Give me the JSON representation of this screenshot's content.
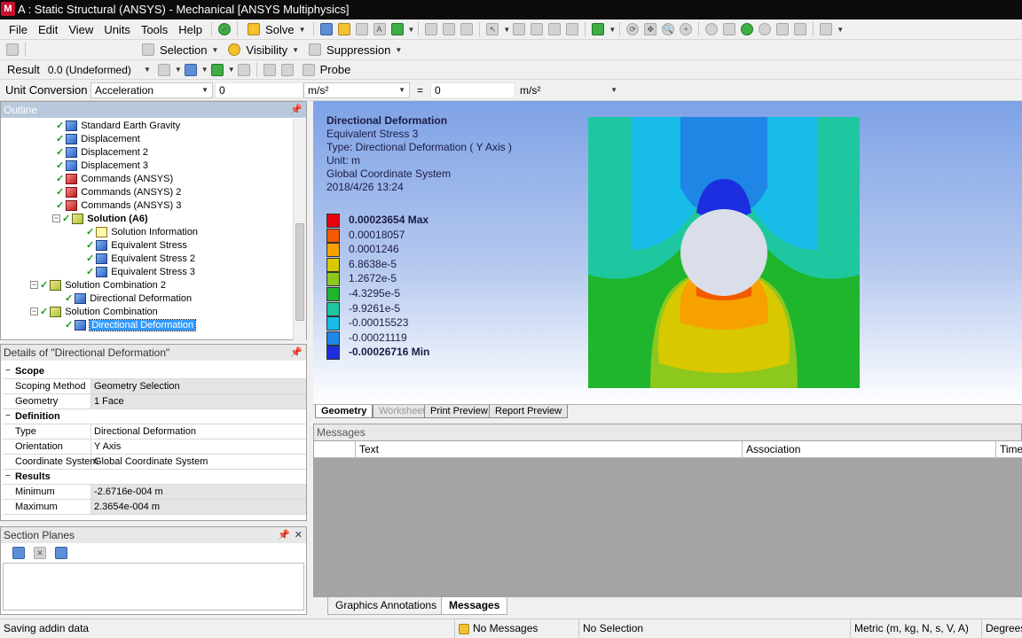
{
  "window": {
    "title": "A : Static Structural (ANSYS) - Mechanical [ANSYS Multiphysics]"
  },
  "menu": [
    "File",
    "Edit",
    "View",
    "Units",
    "Tools",
    "Help"
  ],
  "toolbar": {
    "solve_label": "Solve",
    "selection_label": "Selection",
    "visibility_label": "Visibility",
    "suppression_label": "Suppression",
    "result_label": "Result",
    "result_value": "0.0 (Undeformed)",
    "probe_label": "Probe"
  },
  "unit_conversion": {
    "label": "Unit Conversion",
    "quantity": "Acceleration",
    "left_value": "0",
    "left_unit": "m/s²",
    "equals": "=",
    "right_value": "0",
    "right_unit": "m/s²"
  },
  "outline": {
    "title": "Outline",
    "items": [
      {
        "label": "Standard Earth Gravity"
      },
      {
        "label": "Displacement"
      },
      {
        "label": "Displacement 2"
      },
      {
        "label": "Displacement 3"
      },
      {
        "label": "Commands (ANSYS)"
      },
      {
        "label": "Commands (ANSYS) 2"
      },
      {
        "label": "Commands (ANSYS) 3"
      },
      {
        "label": "Solution (A6)"
      },
      {
        "label": "Solution Information"
      },
      {
        "label": "Equivalent Stress"
      },
      {
        "label": "Equivalent Stress 2"
      },
      {
        "label": "Equivalent Stress 3"
      },
      {
        "label": "Solution Combination 2"
      },
      {
        "label": "Directional Deformation"
      },
      {
        "label": "Solution Combination"
      },
      {
        "label": "Directional Deformation"
      }
    ]
  },
  "details": {
    "title": "Details of \"Directional Deformation\"",
    "groups": [
      {
        "name": "Scope",
        "rows": [
          {
            "key": "Scoping Method",
            "value": "Geometry Selection"
          },
          {
            "key": "Geometry",
            "value": "1 Face"
          }
        ]
      },
      {
        "name": "Definition",
        "rows": [
          {
            "key": "Type",
            "value": "Directional Deformation"
          },
          {
            "key": "Orientation",
            "value": "Y Axis"
          },
          {
            "key": "Coordinate System",
            "value": "Global Coordinate System"
          }
        ]
      },
      {
        "name": "Results",
        "rows": [
          {
            "key": "Minimum",
            "value": "-2.6716e-004 m"
          },
          {
            "key": "Maximum",
            "value": "2.3654e-004 m"
          }
        ]
      }
    ]
  },
  "section_planes": {
    "title": "Section Planes"
  },
  "viewport": {
    "result_title": "Directional Deformation",
    "subtitle": "Equivalent Stress 3",
    "type_line": "Type: Directional Deformation ( Y Axis )",
    "unit_line": "Unit: m",
    "coord_line": "Global Coordinate System",
    "date_line": "2018/4/26 13:24",
    "legend": [
      {
        "label": "0.00023654 Max",
        "color": "#e8000b"
      },
      {
        "label": "0.00018057",
        "color": "#f25a00"
      },
      {
        "label": "0.0001246",
        "color": "#f7a100"
      },
      {
        "label": "6.8638e-5",
        "color": "#d8c800"
      },
      {
        "label": "1.2672e-5",
        "color": "#8cc81e"
      },
      {
        "label": "-4.3295e-5",
        "color": "#1fb52c"
      },
      {
        "label": "-9.9261e-5",
        "color": "#1ec79f"
      },
      {
        "label": "-0.00015523",
        "color": "#17bde8"
      },
      {
        "label": "-0.00021119",
        "color": "#1f86e6"
      },
      {
        "label": "-0.00026716 Min",
        "color": "#1c2ee0"
      }
    ]
  },
  "view_tabs": [
    "Geometry",
    "Worksheet",
    "Print Preview",
    "Report Preview"
  ],
  "messages": {
    "title": "Messages",
    "columns": [
      "Text",
      "Association",
      "Time"
    ]
  },
  "bottom_tabs": [
    "Graphics Annotations",
    "Messages"
  ],
  "status": {
    "left": "Saving addin data",
    "messages": "No Messages",
    "selection": "No Selection",
    "units": "Metric (m, kg, N, s, V, A)",
    "angle": "Degrees"
  },
  "colors": {
    "title_bar": "#0c0c0c",
    "outline_header": "#b9c9dc",
    "selection_blue": "#3399ff",
    "field_green": "#1fb52c"
  }
}
